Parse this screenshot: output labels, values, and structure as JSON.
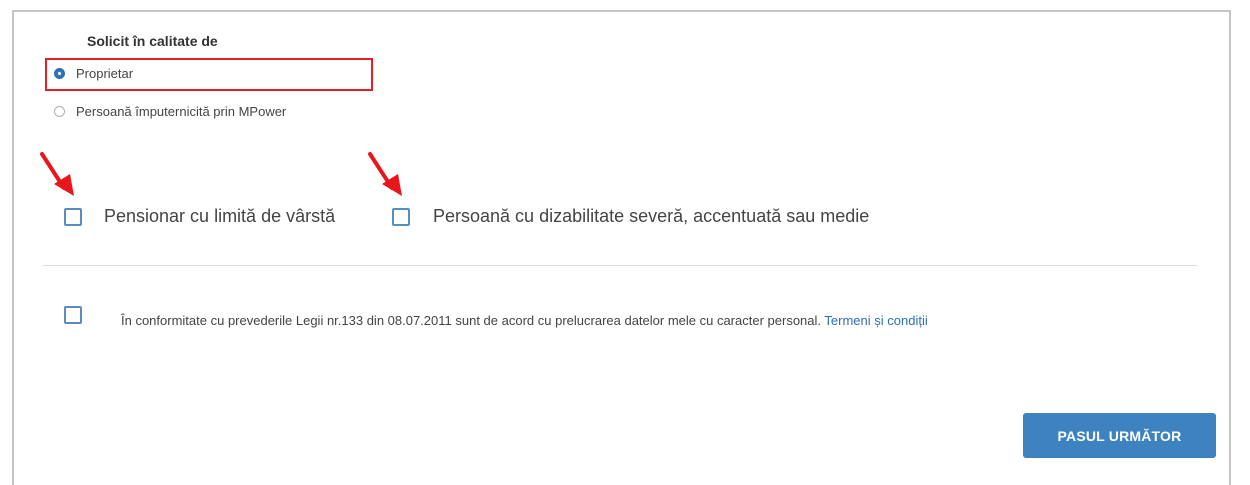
{
  "form": {
    "role_label": "Solicit în calitate de",
    "roles": [
      {
        "label": "Proprietar",
        "selected": true
      },
      {
        "label": "Persoană împuternicită prin MPower",
        "selected": false
      }
    ],
    "categories": [
      {
        "label": "Pensionar cu limită de vârstă",
        "checked": false
      },
      {
        "label": "Persoană cu dizabilitate severă, accentuată sau medie",
        "checked": false
      }
    ],
    "consent": {
      "text": "În conformitate cu prevederile Legii nr.133 din 08.07.2011 sunt de acord cu prelucrarea datelor mele cu caracter personal.",
      "link_label": "Termeni și condiții",
      "checked": false
    },
    "next_button_label": "PASUL URMĂTOR"
  },
  "colors": {
    "accent": "#3e83bf",
    "highlight": "#e32027",
    "arrow": "#e8161b"
  }
}
